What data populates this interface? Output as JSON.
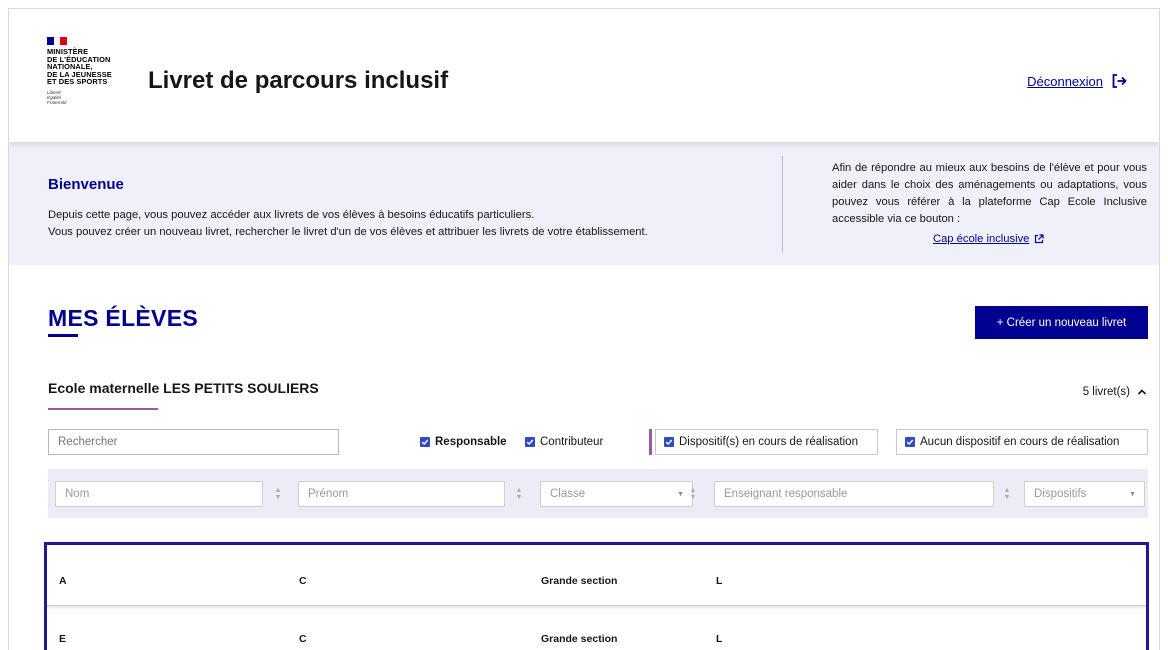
{
  "header": {
    "logo": {
      "flag_colors": [
        "#000091",
        "#ffffff",
        "#e1000f"
      ],
      "lines": [
        "MINISTÈRE",
        "DE L'ÉDUCATION",
        "NATIONALE,",
        "DE LA JEUNESSE",
        "ET DES SPORTS"
      ],
      "motto": [
        "Liberté",
        "Égalité",
        "Fraternité"
      ]
    },
    "app_title": "Livret de parcours inclusif",
    "logout_label": "Déconnexion",
    "logout_icon": "logout-icon"
  },
  "banner": {
    "title": "Bienvenue",
    "text_line1": "Depuis cette page, vous pouvez accéder aux livrets de vos élèves à besoins éducatifs particuliers.",
    "text_line2": "Vous pouvez créer un nouveau livret, rechercher le livret d'un de vos élèves et attribuer les livrets de votre établissement.",
    "side_text": "Afin de répondre au mieux aux besoins de l'élève et pour vous aider dans le choix des aménagements ou adaptations, vous pouvez vous référer à la plateforme Cap Ecole Inclusive accessible via ce bouton :",
    "cap_link_label": "Cap école inclusive",
    "cap_link_icon": "external-link-icon"
  },
  "main": {
    "section_title": "MES ÉLÈVES",
    "create_button_label": "+ Créer un nouveau livret",
    "school_name": "Ecole maternelle LES PETITS SOULIERS",
    "count_label": "5 livret(s)",
    "count_icon": "chevron-up-icon",
    "search_placeholder": "Rechercher",
    "checkboxes": {
      "responsable": "Responsable",
      "contributeur": "Contributeur",
      "dispositif_en_cours": "Dispositif(s) en cours de réalisation",
      "aucun_dispositif": "Aucun dispositif en cours de réalisation"
    },
    "column_filters": {
      "nom": "Nom",
      "prenom": "Prénom",
      "classe": "Classe",
      "enseignant": "Enseignant responsable",
      "dispositifs": "Dispositifs"
    },
    "rows": [
      {
        "nom": "A",
        "prenom": "C",
        "classe": "Grande section",
        "enseignant": "L"
      },
      {
        "nom": "E",
        "prenom": "C",
        "classe": "Grande section",
        "enseignant": "L"
      }
    ]
  },
  "colors": {
    "brand_blue": "#000091",
    "accent_purple": "#a558a0",
    "banner_bg": "#f0f0fb",
    "checkbox_blue": "#2f4cc5",
    "table_border": "#1f1a8f"
  }
}
